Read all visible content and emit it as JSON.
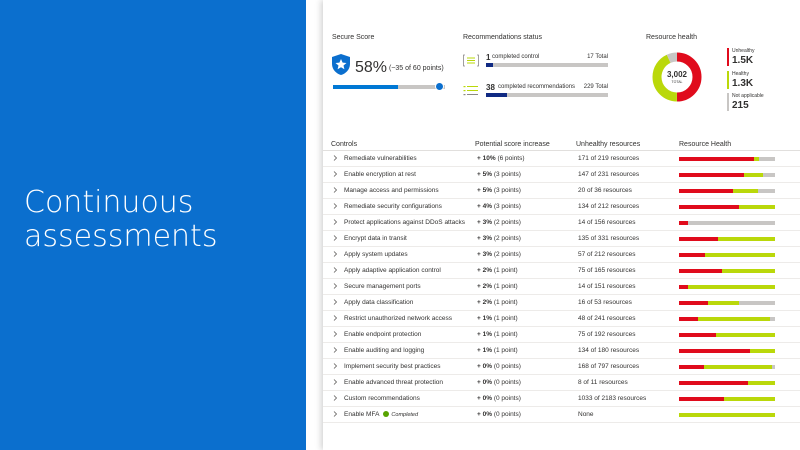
{
  "slide": {
    "headline": "Continuous assessments",
    "accent_color": "#0b6fce"
  },
  "secure_score": {
    "title": "Secure Score",
    "percent": "58%",
    "points": "(~35 of 60 points)",
    "progress": 0.58,
    "icon": "shield-star-icon"
  },
  "recommendations": {
    "title": "Recommendations status",
    "completed_controls": {
      "count": "1",
      "label": "completed control",
      "total": "17 Total",
      "progress": 0.06,
      "icon": "list-icon"
    },
    "completed_recommendations": {
      "count": "38",
      "label": "completed recommendations",
      "total": "229 Total",
      "progress": 0.17,
      "icon": "checklist-icon"
    }
  },
  "resource_health": {
    "title": "Resource health",
    "total": "3,002",
    "total_label": "TOTAL",
    "segments": [
      {
        "label": "Unhealthy",
        "value": "1.5K",
        "fraction": 0.5,
        "color": "#e00b1c"
      },
      {
        "label": "Healthy",
        "value": "1.3K",
        "fraction": 0.43,
        "color": "#bad80a"
      },
      {
        "label": "Not applicable",
        "value": "215",
        "fraction": 0.07,
        "color": "#c8c6c4"
      }
    ]
  },
  "table": {
    "columns": [
      "Controls",
      "Potential score increase",
      "Unhealthy resources",
      "Resource Health"
    ],
    "rows": [
      {
        "control": "Remediate vulnerabilities",
        "increase": "+ 10%",
        "points": "(6 points)",
        "unhealthy": "171 of 219 resources",
        "health": [
          0.78,
          0.05,
          0.17
        ]
      },
      {
        "control": "Enable encryption at rest",
        "increase": "+ 5%",
        "points": "(3 points)",
        "unhealthy": "147 of 231 resources",
        "health": [
          0.68,
          0.2,
          0.12
        ]
      },
      {
        "control": "Manage access and permissions",
        "increase": "+ 5%",
        "points": "(3 points)",
        "unhealthy": "20 of 36 resources",
        "health": [
          0.56,
          0.26,
          0.18
        ]
      },
      {
        "control": "Remediate security configurations",
        "increase": "+ 4%",
        "points": "(3 points)",
        "unhealthy": "134 of 212 resources",
        "health": [
          0.63,
          0.37,
          0.0
        ]
      },
      {
        "control": "Protect applications against DDoS attacks",
        "increase": "+ 3%",
        "points": "(2 points)",
        "unhealthy": "14 of 156 resources",
        "health": [
          0.09,
          0.0,
          0.91
        ]
      },
      {
        "control": "Encrypt data in transit",
        "increase": "+ 3%",
        "points": "(2 points)",
        "unhealthy": "135 of 331 resources",
        "health": [
          0.41,
          0.59,
          0.0
        ]
      },
      {
        "control": "Apply system updates",
        "increase": "+ 3%",
        "points": "(2 points)",
        "unhealthy": "57 of 212 resources",
        "health": [
          0.27,
          0.73,
          0.0
        ]
      },
      {
        "control": "Apply adaptive application control",
        "increase": "+ 2%",
        "points": "(1 point)",
        "unhealthy": "75 of 165 resources",
        "health": [
          0.45,
          0.55,
          0.0
        ]
      },
      {
        "control": "Secure management ports",
        "increase": "+ 2%",
        "points": "(1 point)",
        "unhealthy": "14 of 151 resources",
        "health": [
          0.09,
          0.91,
          0.0
        ]
      },
      {
        "control": "Apply data classification",
        "increase": "+ 2%",
        "points": "(1 point)",
        "unhealthy": "16 of 53 resources",
        "health": [
          0.3,
          0.33,
          0.37
        ]
      },
      {
        "control": "Restrict unauthorized network access",
        "increase": "+ 1%",
        "points": "(1 point)",
        "unhealthy": "48 of 241 resources",
        "health": [
          0.2,
          0.75,
          0.05
        ]
      },
      {
        "control": "Enable endpoint protection",
        "increase": "+ 1%",
        "points": "(1 point)",
        "unhealthy": "75 of 192 resources",
        "health": [
          0.39,
          0.61,
          0.0
        ]
      },
      {
        "control": "Enable auditing and logging",
        "increase": "+ 1%",
        "points": "(1 point)",
        "unhealthy": "134 of 180 resources",
        "health": [
          0.74,
          0.26,
          0.0
        ]
      },
      {
        "control": "Implement security best practices",
        "increase": "+ 0%",
        "points": "(0 points)",
        "unhealthy": "168 of 797 resources",
        "health": [
          0.26,
          0.71,
          0.03
        ]
      },
      {
        "control": "Enable advanced threat protection",
        "increase": "+ 0%",
        "points": "(0 points)",
        "unhealthy": "8 of 11 resources",
        "health": [
          0.72,
          0.28,
          0.0
        ]
      },
      {
        "control": "Custom recommendations",
        "increase": "+ 0%",
        "points": "(0 points)",
        "unhealthy": "1033 of 2183 resources",
        "health": [
          0.47,
          0.53,
          0.0
        ]
      },
      {
        "control": "Enable MFA",
        "badge": "Completed",
        "increase": "+ 0%",
        "points": "(0 points)",
        "unhealthy": "None",
        "health": [
          0.0,
          1.0,
          0.0
        ]
      }
    ]
  }
}
